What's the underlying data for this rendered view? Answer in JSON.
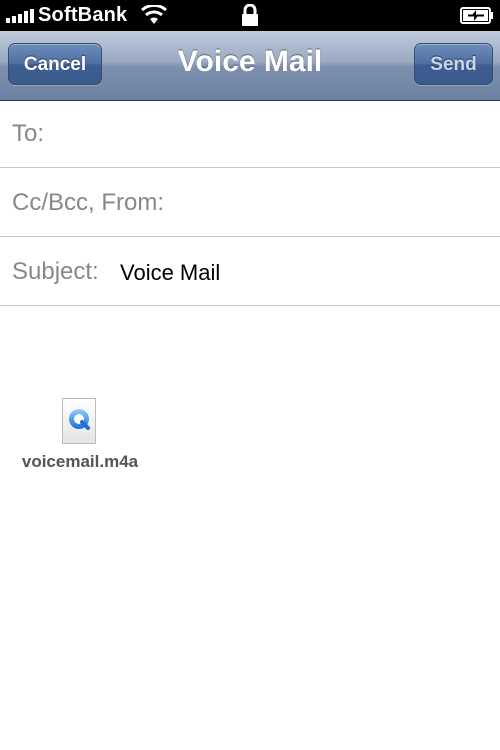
{
  "status_bar": {
    "carrier": "SoftBank",
    "icons": [
      "signal-bars-icon",
      "wifi-icon",
      "lock-icon",
      "battery-charging-icon"
    ]
  },
  "nav": {
    "title": "Voice Mail",
    "cancel_label": "Cancel",
    "send_label": "Send"
  },
  "form": {
    "to_label": "To:",
    "to_value": "",
    "cc_label": "Cc/Bcc, From:",
    "cc_value": "",
    "subject_label": "Subject:",
    "subject_value": "Voice Mail"
  },
  "attachment": {
    "filename": "voicemail.m4a",
    "icon": "quicktime-file-icon"
  },
  "colors": {
    "nav_bar": "#8a9bb7",
    "button": "#4a6a9c",
    "label_gray": "#888888",
    "divider": "#c7c7c7"
  }
}
